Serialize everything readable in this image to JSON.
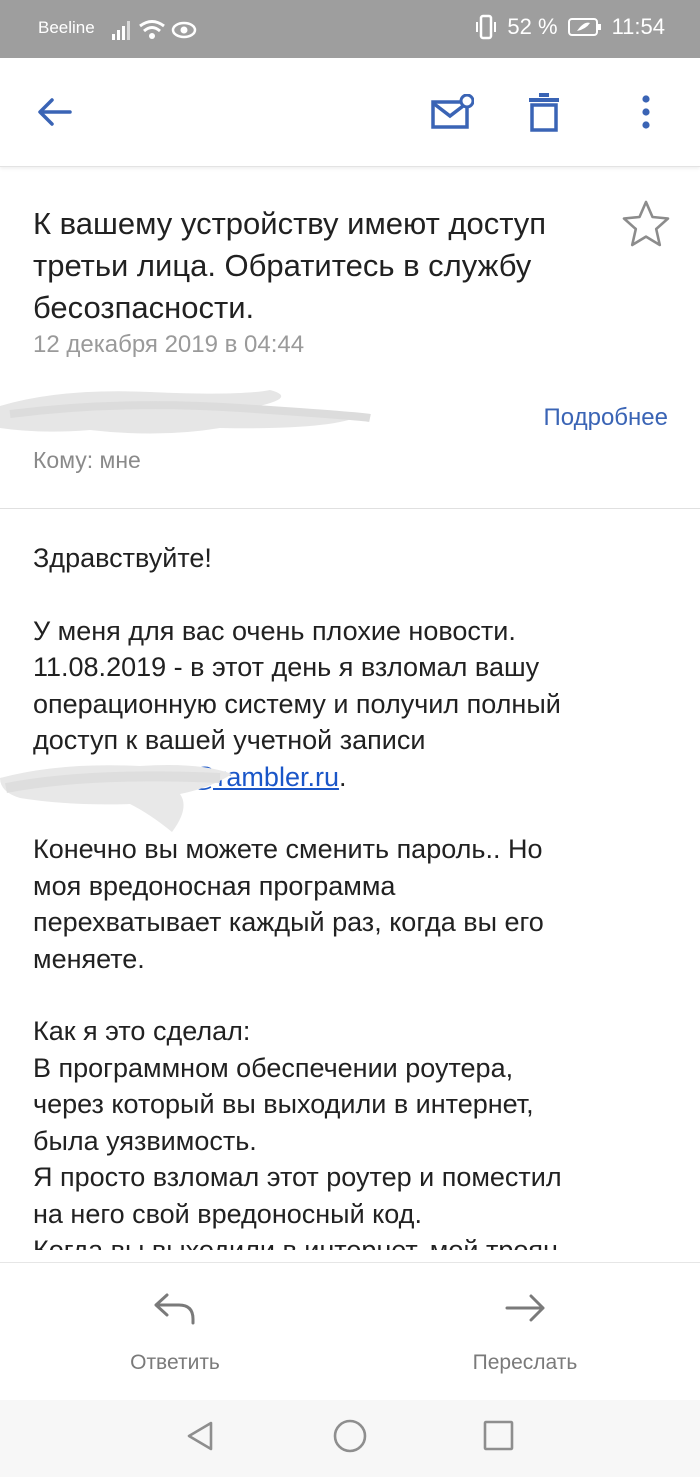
{
  "status_bar": {
    "carrier": "Beeline",
    "battery": "52 %",
    "time": "11:54"
  },
  "toolbar": {
    "back_icon": "arrow-left-icon",
    "mark_icon": "mail-mark-icon",
    "delete_icon": "trash-icon",
    "more_icon": "more-vert-icon"
  },
  "message": {
    "subject": "К вашему устройству имеют доступ третьи лица. Обратитесь в службу бесозпасности.",
    "date": "12 декабря 2019 в 04:44",
    "details_label": "Подробнее",
    "to_line": "Кому: мне",
    "greeting": "Здравствуйте!",
    "p1_lines": [
      "У меня для вас очень плохие новости.",
      "11.08.2019 - в этот день я взломал вашу",
      "операционную систему и получил полный",
      "доступ к вашей учетной записи"
    ],
    "email_visible": "2@rambler.ru",
    "email_suffix": ".",
    "p2_lines": [
      "Конечно вы можете сменить пароль.. Но",
      "моя вредоносная программа",
      "перехватывает каждый раз, когда вы его",
      "меняете."
    ],
    "p3_lines": [
      "Как я это сделал:",
      "В программном обеспечении роутера,",
      "через который вы выходили в интернет,",
      "была уязвимость.",
      "Я просто взломал этот роутер и поместил",
      "на него свой вредоносный код.",
      "Когда вы выходили в интернет, мой троян"
    ]
  },
  "actions": {
    "reply_label": "Ответить",
    "forward_label": "Переслать"
  },
  "colors": {
    "accent": "#3a64b5",
    "status_bar": "#9e9e9e"
  }
}
